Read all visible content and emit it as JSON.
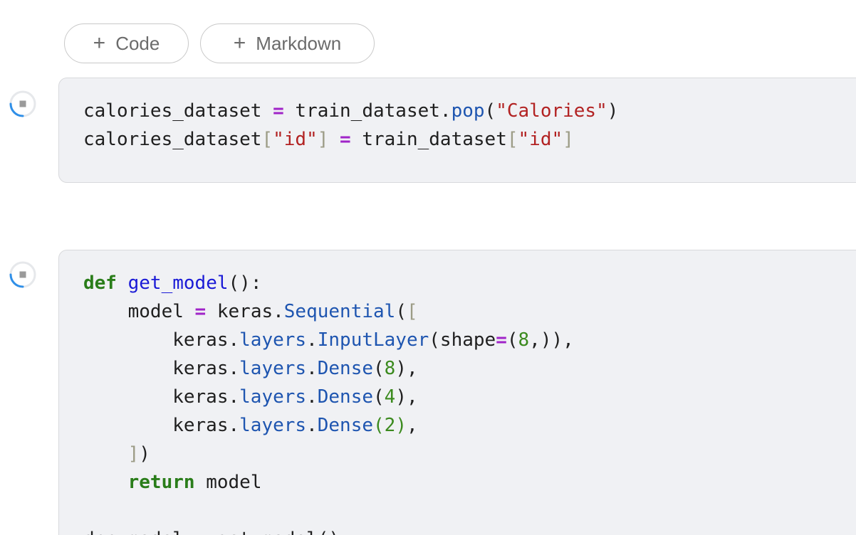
{
  "toolbar": {
    "add_code_label": "Code",
    "add_markdown_label": "Markdown",
    "plus_glyph": "+"
  },
  "icons": {
    "run_indicator": "cell-run-status-icon"
  },
  "colors": {
    "cell_background": "#f0f1f4",
    "keyword": "#2a7d1a",
    "function_name": "#1a1ad6",
    "method": "#1e55b0",
    "string": "#b22222",
    "operator": "#a024c8",
    "number": "#3b8a1e",
    "indicator_blue": "#2f8fe8"
  },
  "cells": [
    {
      "lines": [
        [
          {
            "t": "calories_dataset ",
            "c": "pun"
          },
          {
            "t": "=",
            "c": "op"
          },
          {
            "t": " train_dataset.",
            "c": "pun"
          },
          {
            "t": "pop",
            "c": "mth"
          },
          {
            "t": "(",
            "c": "pun"
          },
          {
            "t": "\"Calories\"",
            "c": "str"
          },
          {
            "t": ")",
            "c": "pun"
          }
        ],
        [
          {
            "t": "calories_dataset",
            "c": "pun"
          },
          {
            "t": "[",
            "c": "br"
          },
          {
            "t": "\"id\"",
            "c": "str"
          },
          {
            "t": "]",
            "c": "br"
          },
          {
            "t": " ",
            "c": "pun"
          },
          {
            "t": "=",
            "c": "op"
          },
          {
            "t": " train_dataset",
            "c": "pun"
          },
          {
            "t": "[",
            "c": "br"
          },
          {
            "t": "\"id\"",
            "c": "str"
          },
          {
            "t": "]",
            "c": "br"
          }
        ]
      ]
    },
    {
      "lines": [
        [
          {
            "t": "def",
            "c": "kw"
          },
          {
            "t": " ",
            "c": "pun"
          },
          {
            "t": "get_model",
            "c": "fn"
          },
          {
            "t": "():",
            "c": "pun"
          }
        ],
        [
          {
            "t": "    model ",
            "c": "pun"
          },
          {
            "t": "=",
            "c": "op"
          },
          {
            "t": " keras.",
            "c": "pun"
          },
          {
            "t": "Sequential",
            "c": "mth"
          },
          {
            "t": "(",
            "c": "pun"
          },
          {
            "t": "[",
            "c": "br"
          }
        ],
        [
          {
            "t": "        keras.",
            "c": "pun"
          },
          {
            "t": "layers",
            "c": "mth"
          },
          {
            "t": ".",
            "c": "pun"
          },
          {
            "t": "InputLayer",
            "c": "mth"
          },
          {
            "t": "(shape",
            "c": "pun"
          },
          {
            "t": "=",
            "c": "op"
          },
          {
            "t": "(",
            "c": "pun"
          },
          {
            "t": "8",
            "c": "num"
          },
          {
            "t": ",)),",
            "c": "pun"
          }
        ],
        [
          {
            "t": "        keras.",
            "c": "pun"
          },
          {
            "t": "layers",
            "c": "mth"
          },
          {
            "t": ".",
            "c": "pun"
          },
          {
            "t": "Dense",
            "c": "mth"
          },
          {
            "t": "(",
            "c": "pun"
          },
          {
            "t": "8",
            "c": "num"
          },
          {
            "t": "),",
            "c": "pun"
          }
        ],
        [
          {
            "t": "        keras.",
            "c": "pun"
          },
          {
            "t": "layers",
            "c": "mth"
          },
          {
            "t": ".",
            "c": "pun"
          },
          {
            "t": "Dense",
            "c": "mth"
          },
          {
            "t": "(",
            "c": "pun"
          },
          {
            "t": "4",
            "c": "num"
          },
          {
            "t": "),",
            "c": "pun"
          }
        ],
        [
          {
            "t": "        keras.",
            "c": "pun"
          },
          {
            "t": "layers",
            "c": "mth"
          },
          {
            "t": ".",
            "c": "pun"
          },
          {
            "t": "Dense",
            "c": "mth"
          },
          {
            "t": "(2)",
            "c": "num"
          },
          {
            "t": ",",
            "c": "pun"
          }
        ],
        [
          {
            "t": "    ",
            "c": "pun"
          },
          {
            "t": "]",
            "c": "br"
          },
          {
            "t": ")",
            "c": "pun"
          }
        ],
        [
          {
            "t": "    ",
            "c": "pun"
          },
          {
            "t": "return",
            "c": "kw"
          },
          {
            "t": " model",
            "c": "pun"
          }
        ],
        [
          {
            "t": "",
            "c": "pun"
          }
        ],
        [
          {
            "t": "dnn_model = get_model()",
            "c": "pun"
          }
        ]
      ]
    }
  ]
}
